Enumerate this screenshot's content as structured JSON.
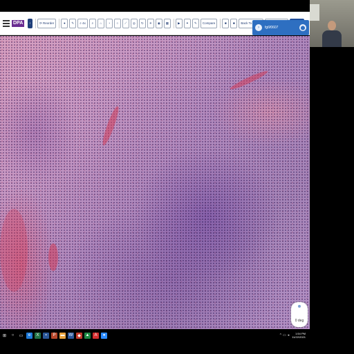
{
  "toolbar": {
    "logo_small": "",
    "logo_text": "DPA",
    "reorder": "Reorder",
    "zoom_label": "4x",
    "compare": "Compare",
    "back_to_slides": "Back To Slides",
    "create_poll": "Create Poll",
    "polls": "Polls"
  },
  "user_panel": {
    "name": "fg6f0607"
  },
  "viewer": {
    "rotation": "0 deg"
  },
  "taskbar": {
    "time": "1:54 PM",
    "date": "11/22/2021"
  },
  "icons": [
    "hamburger-icon",
    "pen-icon",
    "pencil-icon",
    "search-zoom-icon",
    "home-icon",
    "circle-icon",
    "ruler-icon",
    "lasso-icon",
    "refresh-icon",
    "grid-icon",
    "play-icon",
    "stop-icon",
    "windows-start-icon",
    "chevron-icon"
  ]
}
